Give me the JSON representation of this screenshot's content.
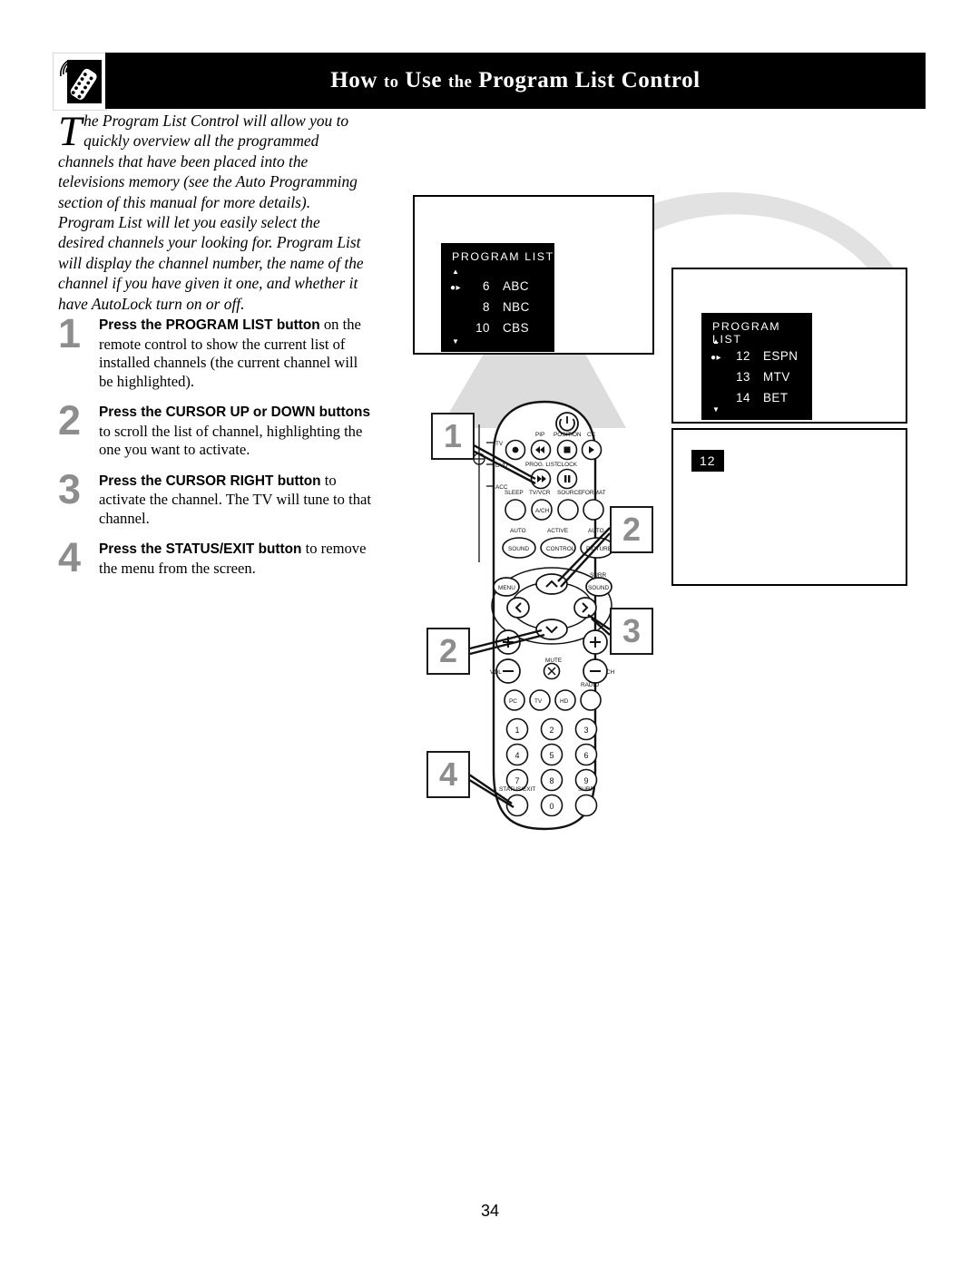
{
  "header": {
    "icon": "remote-control-icon",
    "title_words": [
      "How",
      "to",
      "Use",
      "the",
      "Program",
      "List",
      "Control"
    ],
    "title": "How to Use the Program List Control"
  },
  "intro": {
    "dropcap": "T",
    "text": "he Program List Control will allow you to quickly overview all the programmed channels that have been placed into the televisions memory (see the Auto Programming section of this manual for more details). Program List will let you easily select the desired channels your looking for. Program List will display the channel number, the name of the channel if you have given it one, and whether it have AutoLock turn on or off."
  },
  "steps": [
    {
      "num": "1",
      "bold": "Press the PROGRAM LIST button",
      "rest": " on the remote control to show the current list of installed channels (the current channel will be highlighted)."
    },
    {
      "num": "2",
      "bold": "Press the CURSOR UP or DOWN buttons",
      "rest": " to scroll the list of channel, highlighting the one you want to activate."
    },
    {
      "num": "3",
      "bold": "Press the CURSOR RIGHT button",
      "rest": " to activate the channel. The TV will tune to that channel."
    },
    {
      "num": "4",
      "bold": "Press the STATUS/EXIT button",
      "rest": " to remove the menu from the screen."
    }
  ],
  "tv_screens": [
    {
      "id": "tv-screen-1",
      "osd_title": "PROGRAM LIST",
      "scroll_up": "▲",
      "scroll_down": "▼",
      "rows": [
        {
          "mark": "●▸",
          "channel": "6",
          "name": "ABC"
        },
        {
          "mark": "",
          "channel": "8",
          "name": "NBC"
        },
        {
          "mark": "",
          "channel": "10",
          "name": "CBS"
        }
      ]
    },
    {
      "id": "tv-screen-2",
      "osd_title": "PROGRAM LIST",
      "scroll_up": "▲",
      "scroll_down": "▼",
      "rows": [
        {
          "mark": "●▸",
          "channel": "12",
          "name": "ESPN"
        },
        {
          "mark": "",
          "channel": "13",
          "name": "MTV"
        },
        {
          "mark": "",
          "channel": "14",
          "name": "BET"
        }
      ]
    },
    {
      "id": "tv-screen-3",
      "channel_display": "12"
    }
  ],
  "callouts": [
    {
      "id": "callout-1",
      "label": "1"
    },
    {
      "id": "callout-2-right",
      "label": "2"
    },
    {
      "id": "callout-3",
      "label": "3"
    },
    {
      "id": "callout-2-left",
      "label": "2"
    },
    {
      "id": "callout-4",
      "label": "4"
    }
  ],
  "remote": {
    "device_selectors": [
      "TV",
      "DVD",
      "ACC"
    ],
    "buttons": [
      {
        "name": "power",
        "label": ""
      },
      {
        "name": "record",
        "label": ""
      },
      {
        "name": "pip",
        "label": "PIP"
      },
      {
        "name": "position",
        "label": "POSITION"
      },
      {
        "name": "cc",
        "label": "CC"
      },
      {
        "name": "prog-list",
        "label": "PROG. LIST"
      },
      {
        "name": "clock",
        "label": "CLOCK"
      },
      {
        "name": "sleep",
        "label": "SLEEP"
      },
      {
        "name": "tv-vcr",
        "label": "TV/VCR"
      },
      {
        "name": "a-ch",
        "label": "A/CH"
      },
      {
        "name": "source",
        "label": "SOURCE"
      },
      {
        "name": "format",
        "label": "FORMAT"
      },
      {
        "name": "auto-sound",
        "label": "AUTO"
      },
      {
        "name": "sound",
        "label": "SOUND"
      },
      {
        "name": "active",
        "label": "ACTIVE"
      },
      {
        "name": "control",
        "label": "CONTROL"
      },
      {
        "name": "auto-picture",
        "label": "AUTO"
      },
      {
        "name": "picture",
        "label": "PICTURE"
      },
      {
        "name": "menu",
        "label": "MENU"
      },
      {
        "name": "surr",
        "label": "SURR"
      },
      {
        "name": "surr-sound",
        "label": "SOUND"
      },
      {
        "name": "vol",
        "label": "VOL"
      },
      {
        "name": "mute",
        "label": "MUTE"
      },
      {
        "name": "ch",
        "label": "CH"
      },
      {
        "name": "pc",
        "label": "PC"
      },
      {
        "name": "tv",
        "label": "TV"
      },
      {
        "name": "hd",
        "label": "HD"
      },
      {
        "name": "radio",
        "label": "RADIO"
      },
      {
        "name": "status-exit",
        "label": "STATUS/EXIT"
      },
      {
        "name": "surf",
        "label": "SURF"
      }
    ],
    "keypad": [
      "1",
      "2",
      "3",
      "4",
      "5",
      "6",
      "7",
      "8",
      "9",
      "0"
    ]
  },
  "page_number": "34",
  "colors": {
    "accent_gray": "#8d8d8d",
    "beam_gray": "#dcdcdc",
    "black": "#000000"
  }
}
